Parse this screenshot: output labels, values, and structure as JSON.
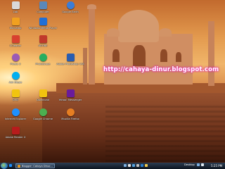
{
  "blog_url": "http://cahaya-dinur.blogspot.com",
  "icons": [
    {
      "label": "Lab",
      "color": "#d9d9d9"
    },
    {
      "label": "Computer",
      "color": "#5b88b8"
    },
    {
      "label": "Google Earth",
      "color": "#3b7dd8"
    },
    {
      "label": "Wincamp",
      "color": "#f0a020"
    },
    {
      "label": "Windows Media Player",
      "color": "#1f6fd6"
    },
    {
      "label": "CCleaner",
      "color": "#d8412f"
    },
    {
      "label": "ADOBE",
      "color": "#c0392b"
    },
    {
      "label": "Picasa 3",
      "color": "#9b59b6"
    },
    {
      "label": "PhotoScape",
      "color": "#27ae60"
    },
    {
      "label": "Adobe Photoshop CS5",
      "color": "#2a5db0"
    },
    {
      "label": "Ask Skype",
      "color": "#00aff0"
    },
    {
      "label": "DVD",
      "color": "#f1c40f"
    },
    {
      "label": "Download",
      "color": "#f1c40f"
    },
    {
      "label": "Yahoo! Messenger",
      "color": "#6a1b9a"
    },
    {
      "label": "Internet Explorer",
      "color": "#1e90ff"
    },
    {
      "label": "Google Chrome",
      "color": "#4caf50"
    },
    {
      "label": "Mozilla Firefox",
      "color": "#e67e22"
    },
    {
      "label": "Adobe Reader X",
      "color": "#b71c1c"
    }
  ],
  "taskbar": {
    "active_window": "Blogger: Cahaya Dinur...",
    "desktop_label": "Desktop",
    "clock": "5:25 PM"
  }
}
